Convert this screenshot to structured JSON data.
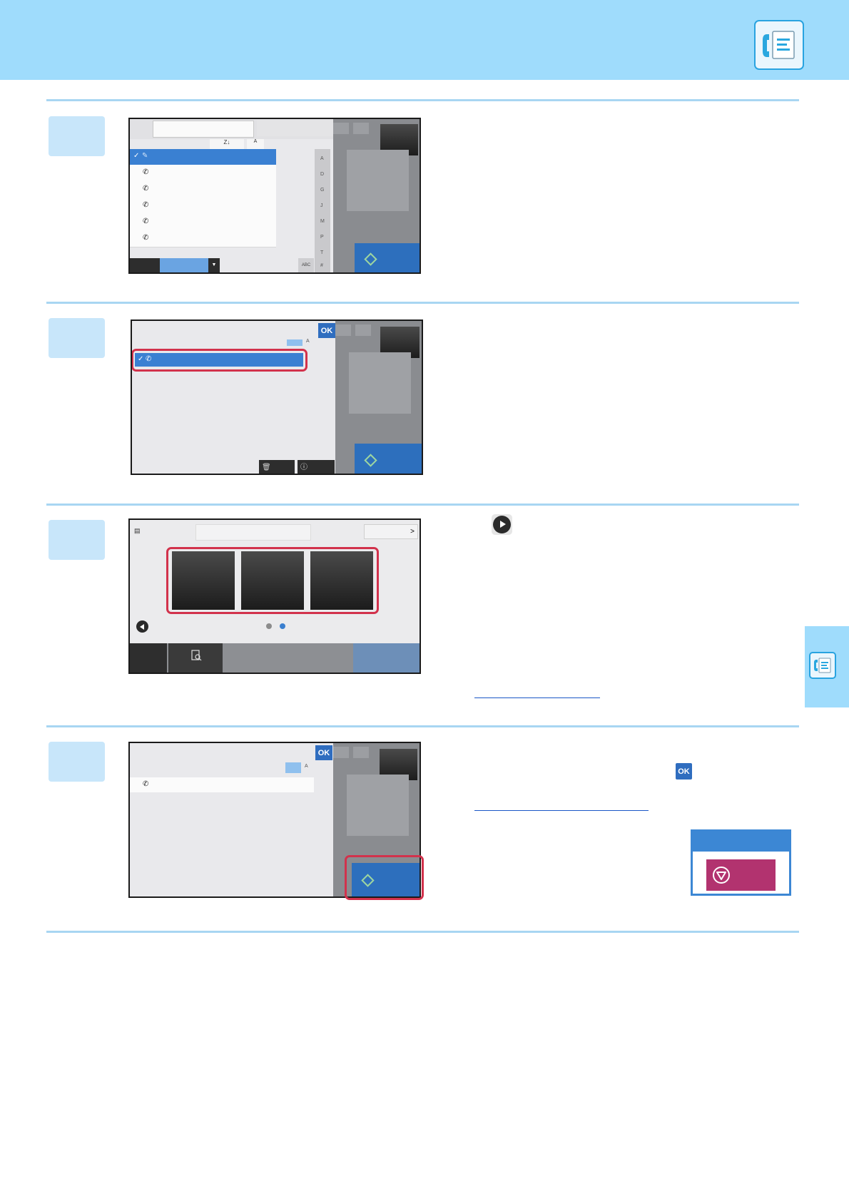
{
  "icons": {
    "header": "fax-icon",
    "side_tab": "fax-icon",
    "ok_inline": "ok-icon",
    "next_page": "play-circle-icon",
    "stop": "stop-icon"
  },
  "labels": {
    "ok": "OK",
    "abc": "ABC",
    "sort": "Z↓",
    "index_letters": [
      "A",
      "D",
      "G",
      "J",
      "M",
      "P",
      "T",
      "#"
    ],
    "page_next": ">"
  },
  "colors": {
    "header": "#9fdcfc",
    "accent_blue": "#2d6fbd",
    "highlight_red": "#d2324c",
    "stop_button": "#b2336f"
  }
}
